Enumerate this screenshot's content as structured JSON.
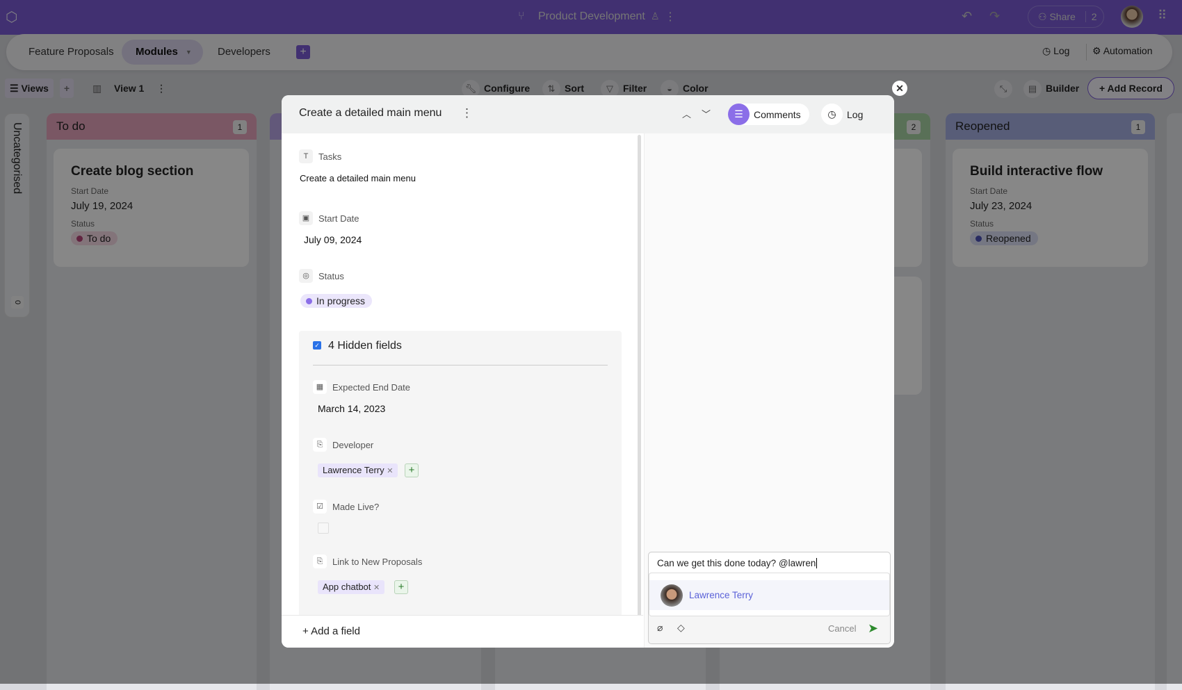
{
  "header": {
    "title": "Product Development",
    "share_label": "Share",
    "share_count": "2"
  },
  "tabs": [
    {
      "label": "Feature Proposals"
    },
    {
      "label": "Modules"
    },
    {
      "label": "Developers"
    }
  ],
  "tabbar_right": {
    "log": "Log",
    "automation": "Automation"
  },
  "toolbar": {
    "views": "Views",
    "view_name": "View 1",
    "configure": "Configure",
    "sort": "Sort",
    "filter": "Filter",
    "color": "Color",
    "builder": "Builder",
    "add_record": "+ Add Record"
  },
  "board": {
    "uncategorised": {
      "label": "Uncategorised",
      "count": "0"
    },
    "columns": [
      {
        "title": "To do",
        "count": "1",
        "color": "#e6a5bd",
        "cards": [
          {
            "title": "Create blog section",
            "start_label": "Start Date",
            "start": "July 19, 2024",
            "status_label": "Status",
            "status": "To do",
            "status_color": "#b8457a"
          }
        ]
      },
      {
        "title": "",
        "count": "2",
        "color": "#a9d3a5"
      },
      {
        "title": "Reopened",
        "count": "1",
        "color": "#a7b0e3",
        "cards": [
          {
            "title": "Build interactive flow",
            "start_label": "Start Date",
            "start": "July 23, 2024",
            "status_label": "Status",
            "status": "Reopened",
            "status_color": "#4c52b8"
          }
        ]
      }
    ]
  },
  "modal": {
    "title": "Create a detailed main menu",
    "comments_tab": "Comments",
    "log_tab": "Log",
    "fields": {
      "tasks": {
        "label": "Tasks",
        "value": "Create a detailed main menu"
      },
      "start": {
        "label": "Start Date",
        "value": "July 09, 2024"
      },
      "status": {
        "label": "Status",
        "value": "In progress",
        "color": "#8b6ee8"
      }
    },
    "hidden": {
      "title": "4 Hidden fields",
      "end": {
        "label": "Expected End Date",
        "value": "March 14, 2023"
      },
      "developer": {
        "label": "Developer",
        "value": "Lawrence Terry"
      },
      "made_live": {
        "label": "Made Live?",
        "checked": false
      },
      "link": {
        "label": "Link to New Proposals",
        "value": "App chatbot"
      }
    },
    "add_field": "+ Add a field",
    "comment": {
      "text": "Can we get this done today? @lawren",
      "suggestion": "Lawrence Terry",
      "cancel": "Cancel"
    }
  }
}
